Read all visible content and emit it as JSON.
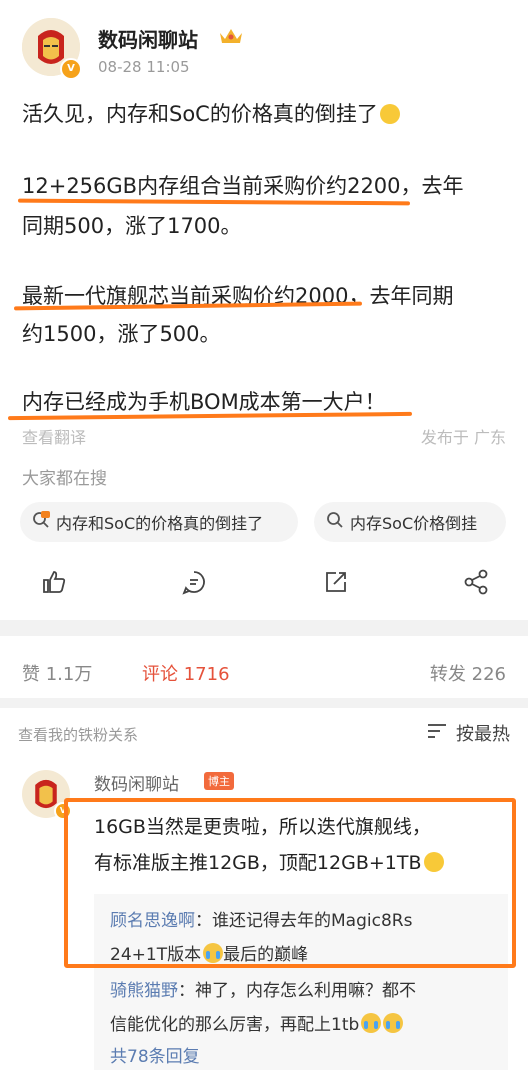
{
  "post": {
    "author": "数码闲聊站",
    "time": "08-28 11:05",
    "lines": [
      "活久见，内存和SoC的价格真的倒挂了",
      "12+256GB内存组合当前采购价约2200，去年",
      "同期500，涨了1700。",
      "最新一代旗舰芯当前采购价约2000，去年同期",
      "约1500，涨了500。",
      "内存已经成为手机BOM成本第一大户！"
    ],
    "translate": "查看翻译",
    "location": "发布于 广东",
    "search_title": "大家都在搜",
    "search_chips": [
      "内存和SoC的价格真的倒挂了",
      "内存SoC价格倒挂"
    ]
  },
  "stats": {
    "likes": "赞 1.1万",
    "comments": "评论 1716",
    "reposts": "转发 226"
  },
  "comments_header": {
    "fans_link": "查看我的铁粉关系",
    "sort_label": "按最热"
  },
  "comment": {
    "author": "数码闲聊站",
    "badge": "博主",
    "lines": [
      "16GB当然是更贵啦，所以迭代旗舰线，",
      "有标准版主推12GB，顶配12GB+1TB"
    ],
    "replies": [
      {
        "user": "顾名思逸啊",
        "text_line1": "：谁还记得去年的Magic8Rs",
        "text_line2": "24+1T版本",
        "text_line2_end": "最后的巅峰"
      },
      {
        "user": "骑熊猫野",
        "text_line1": "：神了，内存怎么利用嘛？都不",
        "text_line2": "信能优化的那么厉害，再配上1tb"
      }
    ],
    "more_replies": "共78条回复"
  },
  "colors": {
    "accent": "#ff7a1a",
    "link": "#5b7cb1",
    "hot": "#e5523b"
  }
}
